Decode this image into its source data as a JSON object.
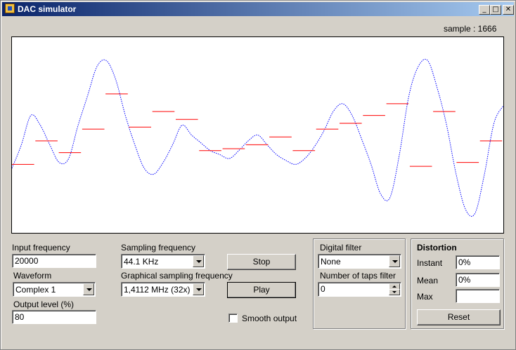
{
  "window": {
    "title": "DAC simulator",
    "minimize_icon": "minimize-icon",
    "maximize_icon": "maximize-icon",
    "close_icon": "close-icon"
  },
  "sample_label": "sample : 1666",
  "colors": {
    "signal": "#0000ff",
    "held": "#ff0000",
    "titlebar_start": "#0a246a",
    "titlebar_end": "#a6caf0"
  },
  "input": {
    "frequency_label": "Input frequency",
    "frequency_value": "20000",
    "waveform_label": "Waveform",
    "waveform_value": "Complex 1",
    "output_level_label": "Output level (%)",
    "output_level_value": "80"
  },
  "sampling": {
    "sampling_label": "Sampling frequency",
    "sampling_value": "44.1 KHz",
    "graphical_label": "Graphical sampling frequency",
    "graphical_value": "1,4112 MHz (32x)"
  },
  "controls": {
    "stop_label": "Stop",
    "play_label": "Play",
    "smooth_label": "Smooth output",
    "smooth_checked": false
  },
  "filter": {
    "group_label": "Digital filter",
    "filter_value": "None",
    "taps_label": "Number of taps filter",
    "taps_value": "0"
  },
  "distortion": {
    "title": "Distortion",
    "instant_label": "Instant",
    "instant_value": "0%",
    "mean_label": "Mean",
    "mean_value": "0%",
    "max_label": "Max",
    "max_value": "",
    "reset_label": "Reset"
  },
  "chart_data": {
    "type": "line",
    "series": [
      {
        "color": "#0000ff",
        "style": "dotted",
        "values": [
          0.33,
          0.45,
          0.6,
          0.55,
          0.45,
          0.36,
          0.38,
          0.55,
          0.7,
          0.85,
          0.88,
          0.78,
          0.6,
          0.45,
          0.33,
          0.3,
          0.36,
          0.45,
          0.55,
          0.5,
          0.46,
          0.42,
          0.4,
          0.38,
          0.42,
          0.47,
          0.5,
          0.45,
          0.4,
          0.37,
          0.35,
          0.38,
          0.44,
          0.52,
          0.62,
          0.66,
          0.6,
          0.48,
          0.35,
          0.2,
          0.18,
          0.4,
          0.7,
          0.85,
          0.88,
          0.74,
          0.55,
          0.3,
          0.12,
          0.1,
          0.3,
          0.56,
          0.65
        ]
      },
      {
        "color": "#ff0000",
        "style": "step",
        "values": [
          0.35,
          0.47,
          0.41,
          0.53,
          0.71,
          0.54,
          0.62,
          0.58,
          0.42,
          0.43,
          0.45,
          0.49,
          0.42,
          0.53,
          0.56,
          0.6,
          0.66,
          0.34,
          0.62,
          0.36,
          0.47
        ]
      }
    ]
  }
}
